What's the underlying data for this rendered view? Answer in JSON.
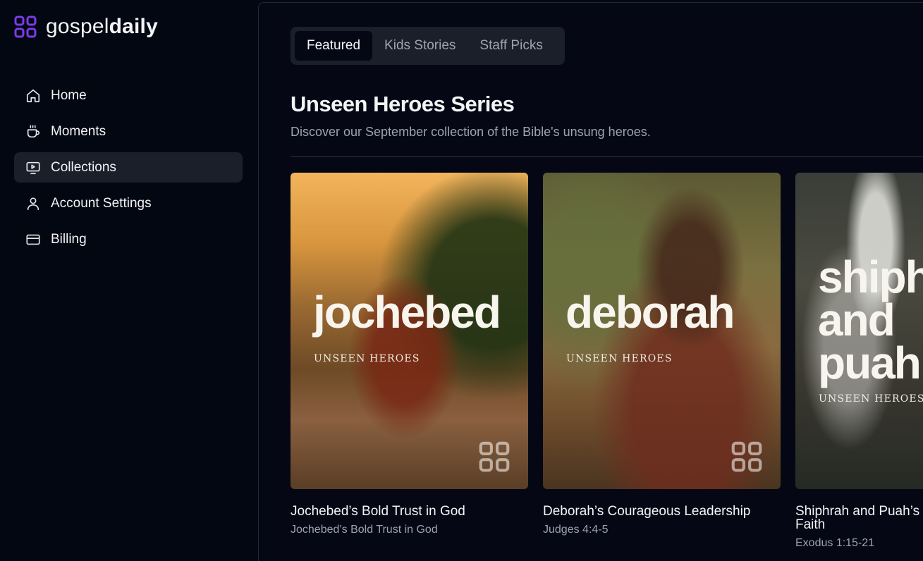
{
  "brand": {
    "name_regular": "gospel",
    "name_bold": "daily",
    "accent_color": "#7c3aed"
  },
  "sidebar": {
    "items": [
      {
        "label": "Home",
        "icon": "home-icon",
        "active": false
      },
      {
        "label": "Moments",
        "icon": "coffee-cup-icon",
        "active": false
      },
      {
        "label": "Collections",
        "icon": "video-screen-icon",
        "active": true
      },
      {
        "label": "Account Settings",
        "icon": "user-icon",
        "active": false
      },
      {
        "label": "Billing",
        "icon": "credit-card-icon",
        "active": false
      }
    ]
  },
  "main": {
    "tabs": [
      {
        "label": "Featured",
        "active": true
      },
      {
        "label": "Kids Stories",
        "active": false
      },
      {
        "label": "Staff Picks",
        "active": false
      }
    ],
    "section": {
      "title": "Unseen Heroes Series",
      "subtitle": "Discover our September collection of the Bible's unsung heroes."
    },
    "cards": [
      {
        "cover_title": "jochebed",
        "cover_series": "UNSEEN HEROES",
        "title": "Jochebed’s Bold Trust in God",
        "subtitle": "Jochebed’s Bold Trust in God"
      },
      {
        "cover_title": "deborah",
        "cover_series": "UNSEEN HEROES",
        "title": "Deborah’s Courageous Leadership",
        "subtitle": "Judges 4:4-5"
      },
      {
        "cover_title_lines": [
          "shiph",
          "and",
          "puah"
        ],
        "cover_series": "UNSEEN HEROES",
        "title_lines": [
          "Shiphrah and Puah’s",
          "Faith"
        ],
        "subtitle": "Exodus 1:15-21"
      }
    ]
  }
}
